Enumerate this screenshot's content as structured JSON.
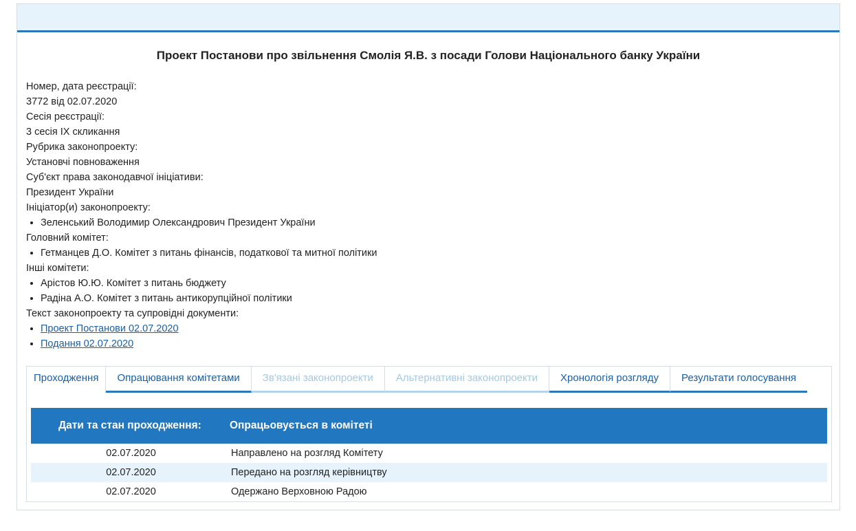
{
  "title": "Проект Постанови про звільнення Смолія Я.В. з посади Голови Національного банку України",
  "info": {
    "reg_label": "Номер, дата реєстрації:",
    "reg_value": "3772 від 02.07.2020",
    "session_label": "Сесія реєстрації:",
    "session_value": "3 сесія IX скликання",
    "rubric_label": "Рубрика законопроекту:",
    "rubric_value": "Установчі повноваження",
    "subject_label": "Суб'єкт права законодавчої ініціативи:",
    "subject_value": "Президент України",
    "initiators_label": "Ініціатор(и) законопроекту:",
    "initiators": [
      "Зеленський Володимир Олександрович Президент України"
    ],
    "main_committee_label": "Головний комітет:",
    "main_committee": [
      "Гетманцев Д.О. Комітет з питань фінансів, податкової та митної політики"
    ],
    "other_committees_label": "Інші комітети:",
    "other_committees": [
      "Арістов Ю.Ю. Комітет з питань бюджету",
      "Радіна А.О. Комітет з питань антикорупційної політики"
    ],
    "docs_label": "Текст законопроекту та супровідні документи:",
    "docs": [
      "Проект Постанови 02.07.2020",
      "Подання 02.07.2020"
    ]
  },
  "tabs": [
    "Проходження",
    "Опрацювання комітетами",
    "Зв'язані законопроекти",
    "Альтернативні законопроекти",
    "Хронологія розгляду",
    "Результати голосування"
  ],
  "table": {
    "head_col1": "Дати та стан проходження:",
    "head_col2": "Опрацьовується в комітеті",
    "rows": [
      {
        "date": "02.07.2020",
        "status": "Направлено на розгляд Комітету"
      },
      {
        "date": "02.07.2020",
        "status": "Передано на розгляд керівництву"
      },
      {
        "date": "02.07.2020",
        "status": "Одержано Верховною Радою"
      }
    ]
  }
}
